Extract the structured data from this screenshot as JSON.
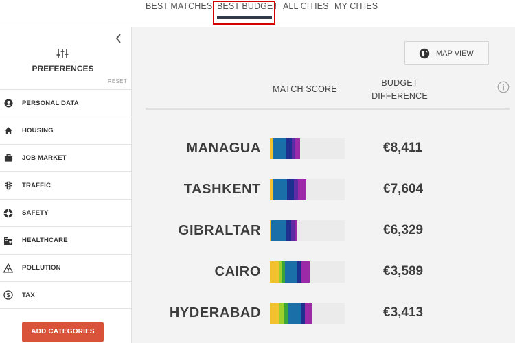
{
  "tabs": [
    {
      "label": "BEST MATCHES",
      "active": false
    },
    {
      "label": "BEST BUDGET",
      "active": true
    },
    {
      "label": "ALL CITIES",
      "active": false
    },
    {
      "label": "MY CITIES",
      "active": false
    }
  ],
  "sidebar": {
    "title": "PREFERENCES",
    "reset_label": "RESET",
    "items": [
      {
        "label": "PERSONAL DATA",
        "icon": "person-icon"
      },
      {
        "label": "HOUSING",
        "icon": "house-icon"
      },
      {
        "label": "JOB MARKET",
        "icon": "briefcase-icon"
      },
      {
        "label": "TRAFFIC",
        "icon": "traffic-light-icon"
      },
      {
        "label": "SAFETY",
        "icon": "lifebuoy-icon"
      },
      {
        "label": "HEALTHCARE",
        "icon": "hospital-icon"
      },
      {
        "label": "POLLUTION",
        "icon": "hazard-icon"
      },
      {
        "label": "TAX",
        "icon": "dollar-coin-icon"
      }
    ],
    "add_button": "ADD CATEGORIES"
  },
  "main": {
    "map_button": "MAP VIEW",
    "col_score": "MATCH SCORE",
    "col_budget_line1": "BUDGET",
    "col_budget_line2": "DIFFERENCE",
    "rows": [
      {
        "city": "MANAGUA",
        "budget": "€8,411",
        "segments": [
          {
            "share": 0.04,
            "color": "#f2c12e"
          },
          {
            "share": 0.18,
            "color": "#1a6fa8"
          },
          {
            "share": 0.07,
            "color": "#1d2f8f"
          },
          {
            "share": 0.05,
            "color": "#5b2ca3"
          },
          {
            "share": 0.06,
            "color": "#9c2aa8"
          }
        ]
      },
      {
        "city": "TASHKENT",
        "budget": "€7,604",
        "segments": [
          {
            "share": 0.04,
            "color": "#f2c12e"
          },
          {
            "share": 0.19,
            "color": "#1a6fa8"
          },
          {
            "share": 0.09,
            "color": "#1d2f8f"
          },
          {
            "share": 0.06,
            "color": "#5b2ca3"
          },
          {
            "share": 0.11,
            "color": "#9c2aa8"
          }
        ]
      },
      {
        "city": "GIBRALTAR",
        "budget": "€6,329",
        "segments": [
          {
            "share": 0.02,
            "color": "#f2c12e"
          },
          {
            "share": 0.2,
            "color": "#1a6fa8"
          },
          {
            "share": 0.06,
            "color": "#1d2f8f"
          },
          {
            "share": 0.05,
            "color": "#5b2ca3"
          },
          {
            "share": 0.04,
            "color": "#9c2aa8"
          }
        ]
      },
      {
        "city": "CAIRO",
        "budget": "€3,589",
        "segments": [
          {
            "share": 0.12,
            "color": "#f2c12e"
          },
          {
            "share": 0.04,
            "color": "#9bd12a"
          },
          {
            "share": 0.04,
            "color": "#3aa637"
          },
          {
            "share": 0.16,
            "color": "#1a6fa8"
          },
          {
            "share": 0.06,
            "color": "#1d2f8f"
          },
          {
            "share": 0.11,
            "color": "#9c2aa8"
          }
        ]
      },
      {
        "city": "HYDERABAD",
        "budget": "€3,413",
        "segments": [
          {
            "share": 0.12,
            "color": "#f2c12e"
          },
          {
            "share": 0.06,
            "color": "#9bd12a"
          },
          {
            "share": 0.06,
            "color": "#3aa637"
          },
          {
            "share": 0.17,
            "color": "#1a6fa8"
          },
          {
            "share": 0.06,
            "color": "#1d2f8f"
          },
          {
            "share": 0.1,
            "color": "#9c2aa8"
          }
        ]
      }
    ]
  }
}
